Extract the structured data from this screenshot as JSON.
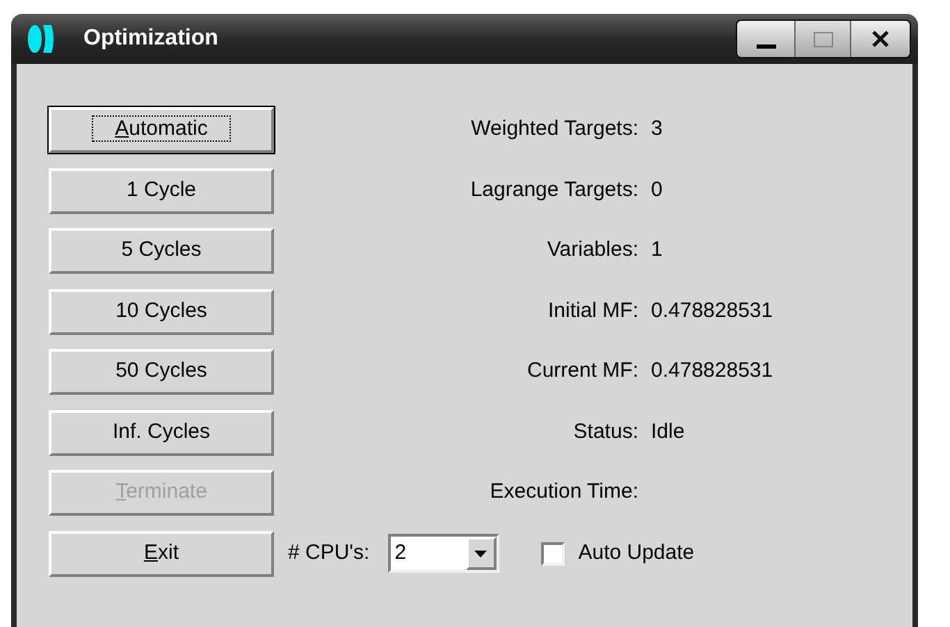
{
  "window": {
    "title": "Optimization"
  },
  "buttons": [
    {
      "label": "Automatic",
      "focused": true,
      "disabled": false,
      "underline_first": true
    },
    {
      "label": "1 Cycle",
      "focused": false,
      "disabled": false,
      "underline_first": false
    },
    {
      "label": "5 Cycles",
      "focused": false,
      "disabled": false,
      "underline_first": false
    },
    {
      "label": "10 Cycles",
      "focused": false,
      "disabled": false,
      "underline_first": false
    },
    {
      "label": "50 Cycles",
      "focused": false,
      "disabled": false,
      "underline_first": false
    },
    {
      "label": "Inf. Cycles",
      "focused": false,
      "disabled": false,
      "underline_first": false
    },
    {
      "label": "Terminate",
      "focused": false,
      "disabled": true,
      "underline_first": true
    },
    {
      "label": "Exit",
      "focused": false,
      "disabled": false,
      "underline_first": true
    }
  ],
  "fields": [
    {
      "label": "Weighted Targets:",
      "value": "3"
    },
    {
      "label": "Lagrange Targets:",
      "value": "0"
    },
    {
      "label": "Variables:",
      "value": "1"
    },
    {
      "label": "Initial MF:",
      "value": "0.478828531"
    },
    {
      "label": "Current MF:",
      "value": "0.478828531"
    },
    {
      "label": "Status:",
      "value": "Idle"
    },
    {
      "label": "Execution Time:"
    }
  ],
  "cpus": {
    "label": "# CPU's:",
    "value": "2"
  },
  "auto_update": {
    "label": "Auto Update",
    "checked": false
  }
}
